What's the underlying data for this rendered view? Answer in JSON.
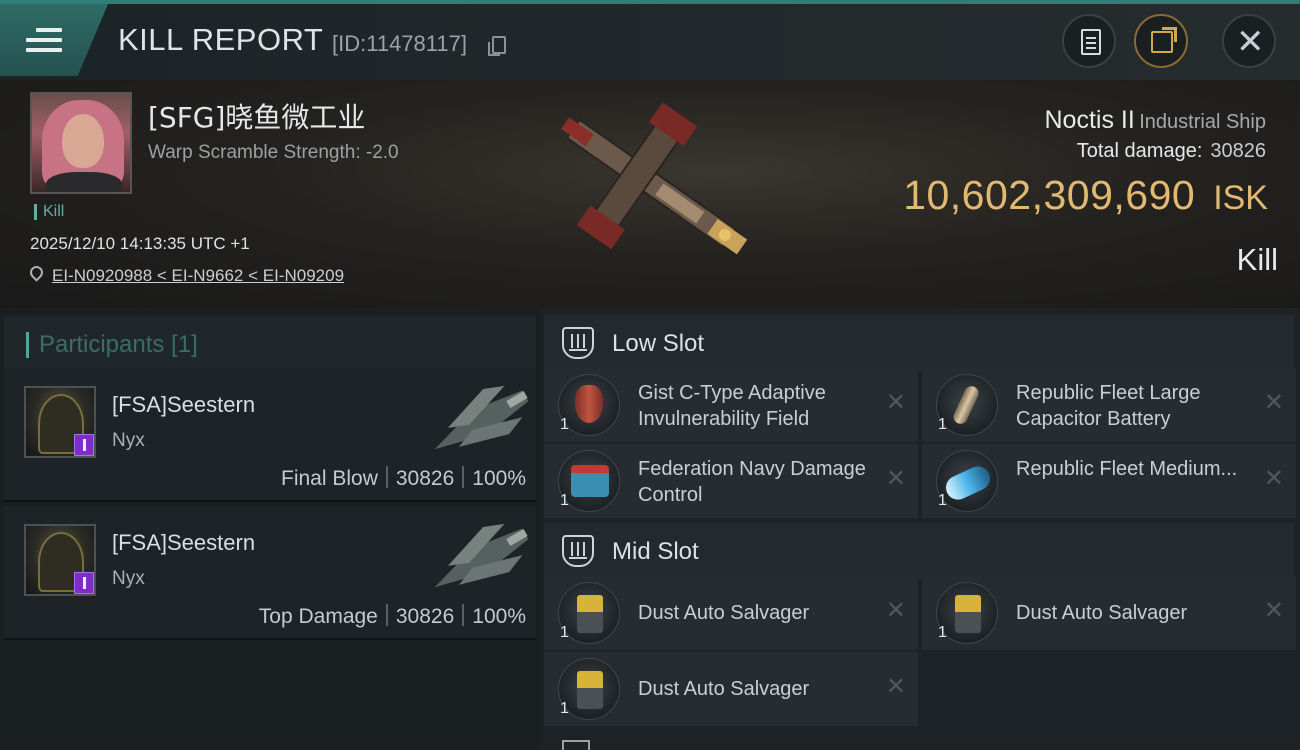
{
  "header": {
    "title": "KILL REPORT",
    "kill_id": "[ID:11478117]"
  },
  "victim": {
    "name": "[SFG]晓鱼微工业",
    "warp_scramble": "Warp Scramble Strength: -2.0",
    "tag": "Kill",
    "timestamp": "2025/12/10 14:13:35 UTC +1",
    "location": "EI-N0920988 < EI-N9662 < EI-N09209",
    "ship_name": "Noctis II",
    "ship_class": "Industrial Ship",
    "total_damage_label": "Total damage:",
    "total_damage": "30826",
    "isk_value": "10,602,309,690",
    "isk_unit": "ISK",
    "result": "Kill"
  },
  "participants": {
    "header": "Participants [1]",
    "rows": [
      {
        "name": "[FSA]Seestern",
        "ship": "Nyx",
        "role": "Final Blow",
        "damage": "30826",
        "percent": "100%"
      },
      {
        "name": "[FSA]Seestern",
        "ship": "Nyx",
        "role": "Top Damage",
        "damage": "30826",
        "percent": "100%"
      }
    ]
  },
  "fitting": {
    "low_slot": {
      "title": "Low Slot",
      "modules": [
        {
          "name": "Gist C-Type Adaptive Invulnerability Field",
          "qty": "1",
          "icon": "shield-module-icon"
        },
        {
          "name": "Republic Fleet Large Capacitor Battery",
          "qty": "1",
          "icon": "capacitor-battery-icon"
        },
        {
          "name": "Federation Navy Damage Control",
          "qty": "1",
          "icon": "damage-control-icon"
        },
        {
          "name": "Republic Fleet Medium...",
          "qty": "1",
          "icon": "booster-icon"
        }
      ]
    },
    "mid_slot": {
      "title": "Mid Slot",
      "modules": [
        {
          "name": "Dust Auto Salvager",
          "qty": "1",
          "icon": "salvager-icon"
        },
        {
          "name": "Dust Auto Salvager",
          "qty": "1",
          "icon": "salvager-icon"
        },
        {
          "name": "Dust Auto Salvager",
          "qty": "1",
          "icon": "salvager-icon"
        }
      ]
    },
    "remove_glyph": "✕"
  },
  "colors": {
    "accent": "#2f7f78",
    "isk_gold": "#e2b970",
    "badge_purple": "#7c2fc4"
  }
}
